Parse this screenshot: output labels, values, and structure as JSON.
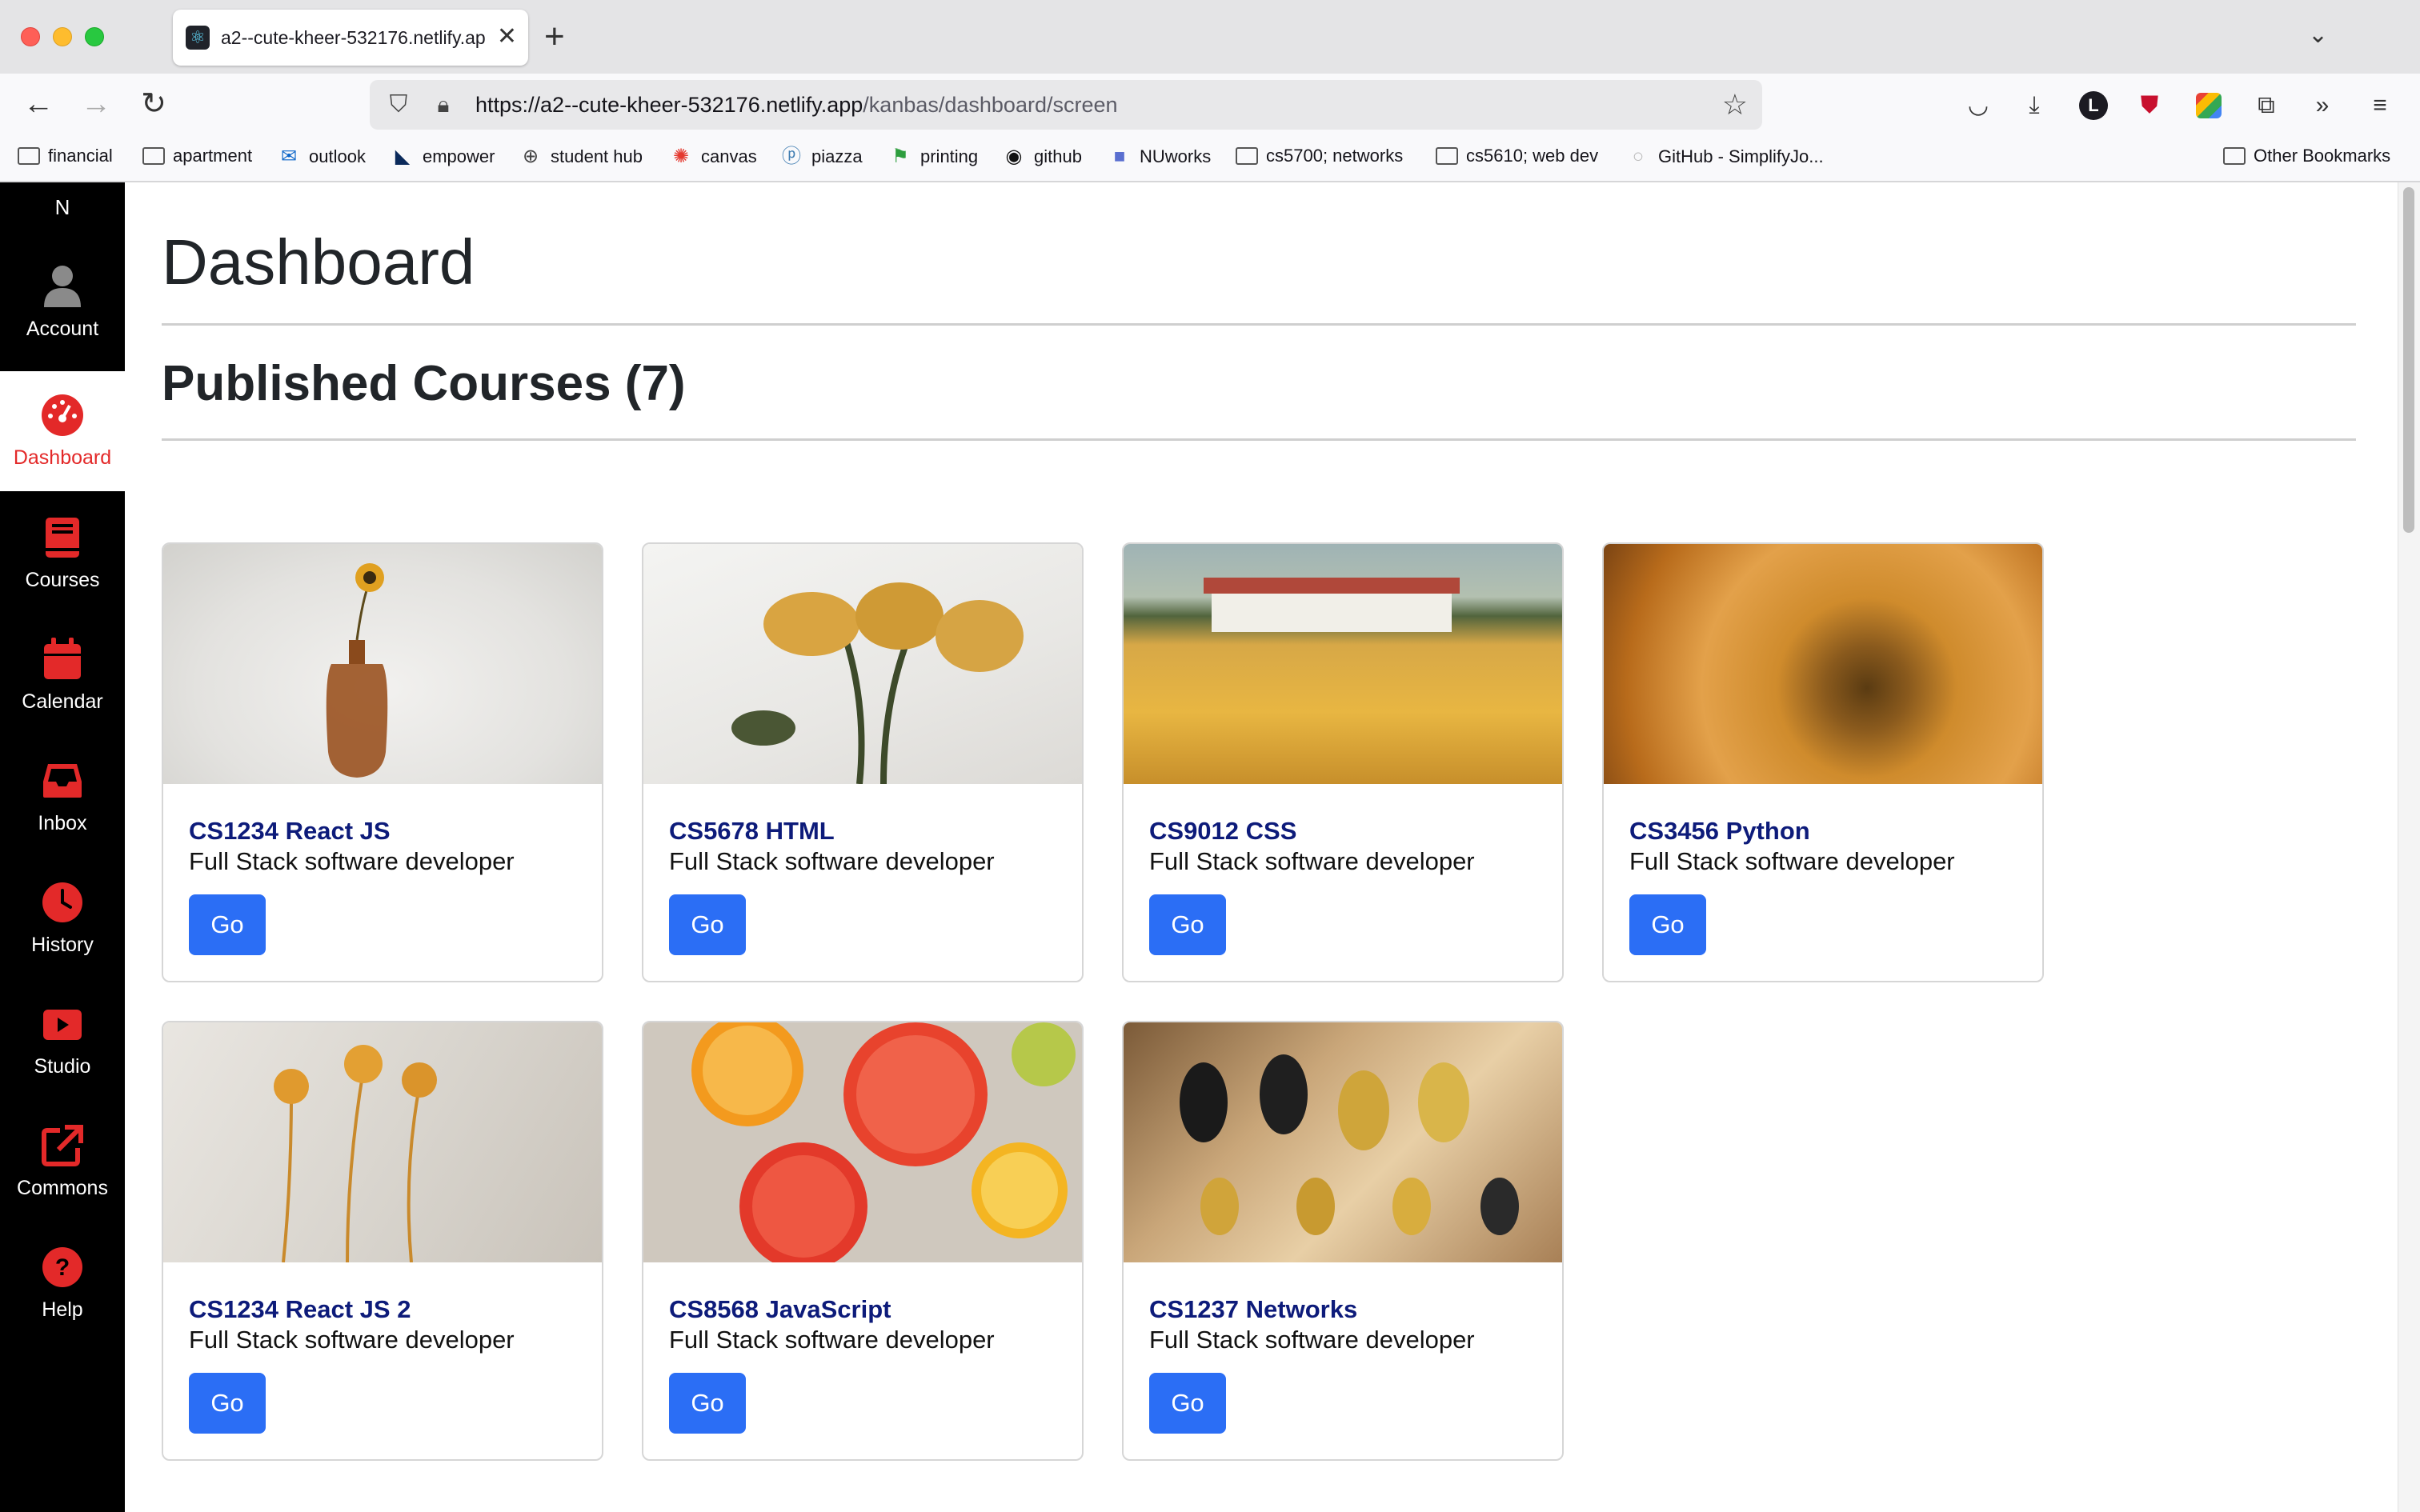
{
  "browser": {
    "tab_title": "a2--cute-kheer-532176.netlify.app",
    "url_host": "https://a2--cute-kheer-532176.netlify.app",
    "url_path": "/kanbas/dashboard/screen",
    "bookmarks": [
      {
        "label": "financial",
        "icon": "folder-icon"
      },
      {
        "label": "apartment",
        "icon": "folder-icon"
      },
      {
        "label": "outlook",
        "icon": "outlook-icon"
      },
      {
        "label": "empower",
        "icon": "empower-icon"
      },
      {
        "label": "student hub",
        "icon": "globe-icon"
      },
      {
        "label": "canvas",
        "icon": "canvas-icon"
      },
      {
        "label": "piazza",
        "icon": "piazza-icon"
      },
      {
        "label": "printing",
        "icon": "flag-icon"
      },
      {
        "label": "github",
        "icon": "github-icon"
      },
      {
        "label": "NUworks",
        "icon": "nuworks-icon"
      },
      {
        "label": "cs5700; networks",
        "icon": "folder-icon"
      },
      {
        "label": "cs5610; web dev",
        "icon": "folder-icon"
      },
      {
        "label": "GitHub - SimplifyJo...",
        "icon": "github-icon"
      }
    ],
    "other_bookmarks": "Other Bookmarks"
  },
  "sidebar": {
    "brand": "N",
    "items": [
      {
        "label": "Account",
        "icon": "user-icon",
        "active": false
      },
      {
        "label": "Dashboard",
        "icon": "dashboard-icon",
        "active": true
      },
      {
        "label": "Courses",
        "icon": "book-icon",
        "active": false
      },
      {
        "label": "Calendar",
        "icon": "calendar-icon",
        "active": false
      },
      {
        "label": "Inbox",
        "icon": "inbox-icon",
        "active": false
      },
      {
        "label": "History",
        "icon": "clock-icon",
        "active": false
      },
      {
        "label": "Studio",
        "icon": "tv-icon",
        "active": false
      },
      {
        "label": "Commons",
        "icon": "external-link-icon",
        "active": false
      },
      {
        "label": "Help",
        "icon": "question-icon",
        "active": false
      }
    ]
  },
  "main": {
    "title": "Dashboard",
    "section_title": "Published Courses (7)",
    "go_label": "Go",
    "courses": [
      {
        "title": "CS1234 React JS",
        "subtitle": "Full Stack software developer"
      },
      {
        "title": "CS5678 HTML",
        "subtitle": "Full Stack software developer"
      },
      {
        "title": "CS9012 CSS",
        "subtitle": "Full Stack software developer"
      },
      {
        "title": "CS3456 Python",
        "subtitle": "Full Stack software developer"
      },
      {
        "title": "CS1234 React JS 2",
        "subtitle": "Full Stack software developer"
      },
      {
        "title": "CS8568 JavaScript",
        "subtitle": "Full Stack software developer"
      },
      {
        "title": "CS1237 Networks",
        "subtitle": "Full Stack software developer"
      }
    ]
  },
  "colors": {
    "accent_red": "#e32929",
    "button_blue": "#2b6ef5",
    "course_title": "#0d1b7a",
    "sidebar_bg": "#000000"
  }
}
